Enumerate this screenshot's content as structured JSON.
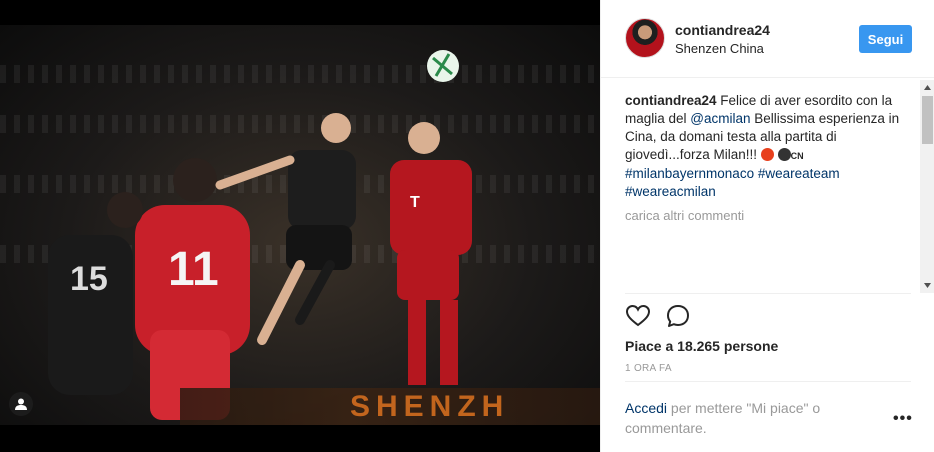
{
  "post": {
    "username": "contiandrea24",
    "location": "Shenzen China",
    "follow_label": "Segui"
  },
  "caption": {
    "username": "contiandrea24",
    "text_1": " Felice di aver esordito con la maglia del ",
    "mention": "@acmilan",
    "text_2": " Bellissima esperienza in Cina, da domani testa alla partita di giovedì...forza Milan!!! ",
    "emoji_colors": [
      "#e8401d",
      "#333333"
    ],
    "flag_text": "CN",
    "hashtags": [
      "#milanbayernmonaco",
      "#weareateam",
      "#weareacmilan"
    ]
  },
  "load_more_label": "carica altri commenti",
  "likes_text": "Piace a 18.265 persone",
  "time_text": "1 ORA FA",
  "login": {
    "link": "Accedi",
    "text": " per mettere \"Mi piace\" o commentare."
  },
  "more_label": "•••",
  "photo_banner_text": "SHENZH",
  "colors": {
    "accent": "#3897f0",
    "link": "#003569",
    "muted": "#999999"
  }
}
